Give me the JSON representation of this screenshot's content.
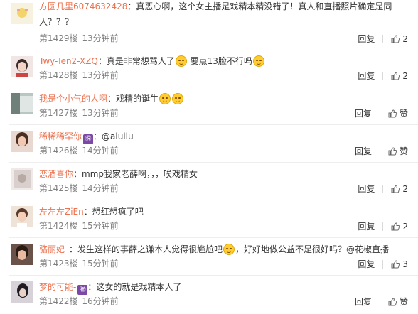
{
  "comments": [
    {
      "username": "方圆几里6074632428",
      "pre": "：真恶心啊，这个女主播是戏精本精没错了！真人和直播照片确定是同一人？？？",
      "mid": "",
      "post": "",
      "floor": "第1429楼",
      "time": "13分钟前",
      "reply_label": "回复",
      "like_label": "2",
      "avatar_color": "#f6eecf"
    },
    {
      "username": "Twy-Ten2-XZQ",
      "pre": "：真是非常想骂人了",
      "mid": " 要点13脸不行吗",
      "post": "",
      "floor": "第1428楼",
      "time": "13分钟前",
      "reply_label": "回复",
      "like_label": "2",
      "avatar_color": "#e9c9c2"
    },
    {
      "username": "我是个小气的人啊",
      "pre": "：戏精的诞生",
      "mid": "",
      "post": "",
      "floor": "第1427楼",
      "time": "13分钟前",
      "reply_label": "回复",
      "like_label": "赞",
      "avatar_color": "#8b9b96"
    },
    {
      "username": "稀稀稀罕你",
      "badge": "㊗",
      "pre": "：@aluilu",
      "mid": "",
      "post": "",
      "floor": "第1426楼",
      "time": "14分钟前",
      "reply_label": "回复",
      "like_label": "赞",
      "avatar_color": "#caa08a"
    },
    {
      "username": "恋酒喜你",
      "pre": "：mmp我家老薛啊，，，唉戏精女",
      "mid": "",
      "post": "",
      "floor": "第1425楼",
      "time": "14分钟前",
      "reply_label": "回复",
      "like_label": "2",
      "avatar_color": "#d8d2cf"
    },
    {
      "username": "左左左ZiEn",
      "pre": "：想红想疯了吧",
      "mid": "",
      "post": "",
      "floor": "第1424楼",
      "time": "15分钟前",
      "reply_label": "回复",
      "like_label": "2",
      "avatar_color": "#d7b79c"
    },
    {
      "username": "骆丽妃_",
      "pre": "：发生这样的事薛之谦本人觉得很尴尬吧",
      "mid": "，好好地做公益不是很好吗？@花椒直播",
      "post": "",
      "floor": "第1423楼",
      "time": "15分钟前",
      "reply_label": "回复",
      "like_label": "3",
      "avatar_color": "#8a6a5a"
    },
    {
      "username": "梦的可能-",
      "badge": "㊗",
      "pre": "：这女的就是戏精本人了",
      "mid": "",
      "post": "",
      "floor": "第1422楼",
      "time": "16分钟前",
      "reply_label": "回复",
      "like_label": "赞",
      "avatar_color": "#5e5a66"
    }
  ]
}
